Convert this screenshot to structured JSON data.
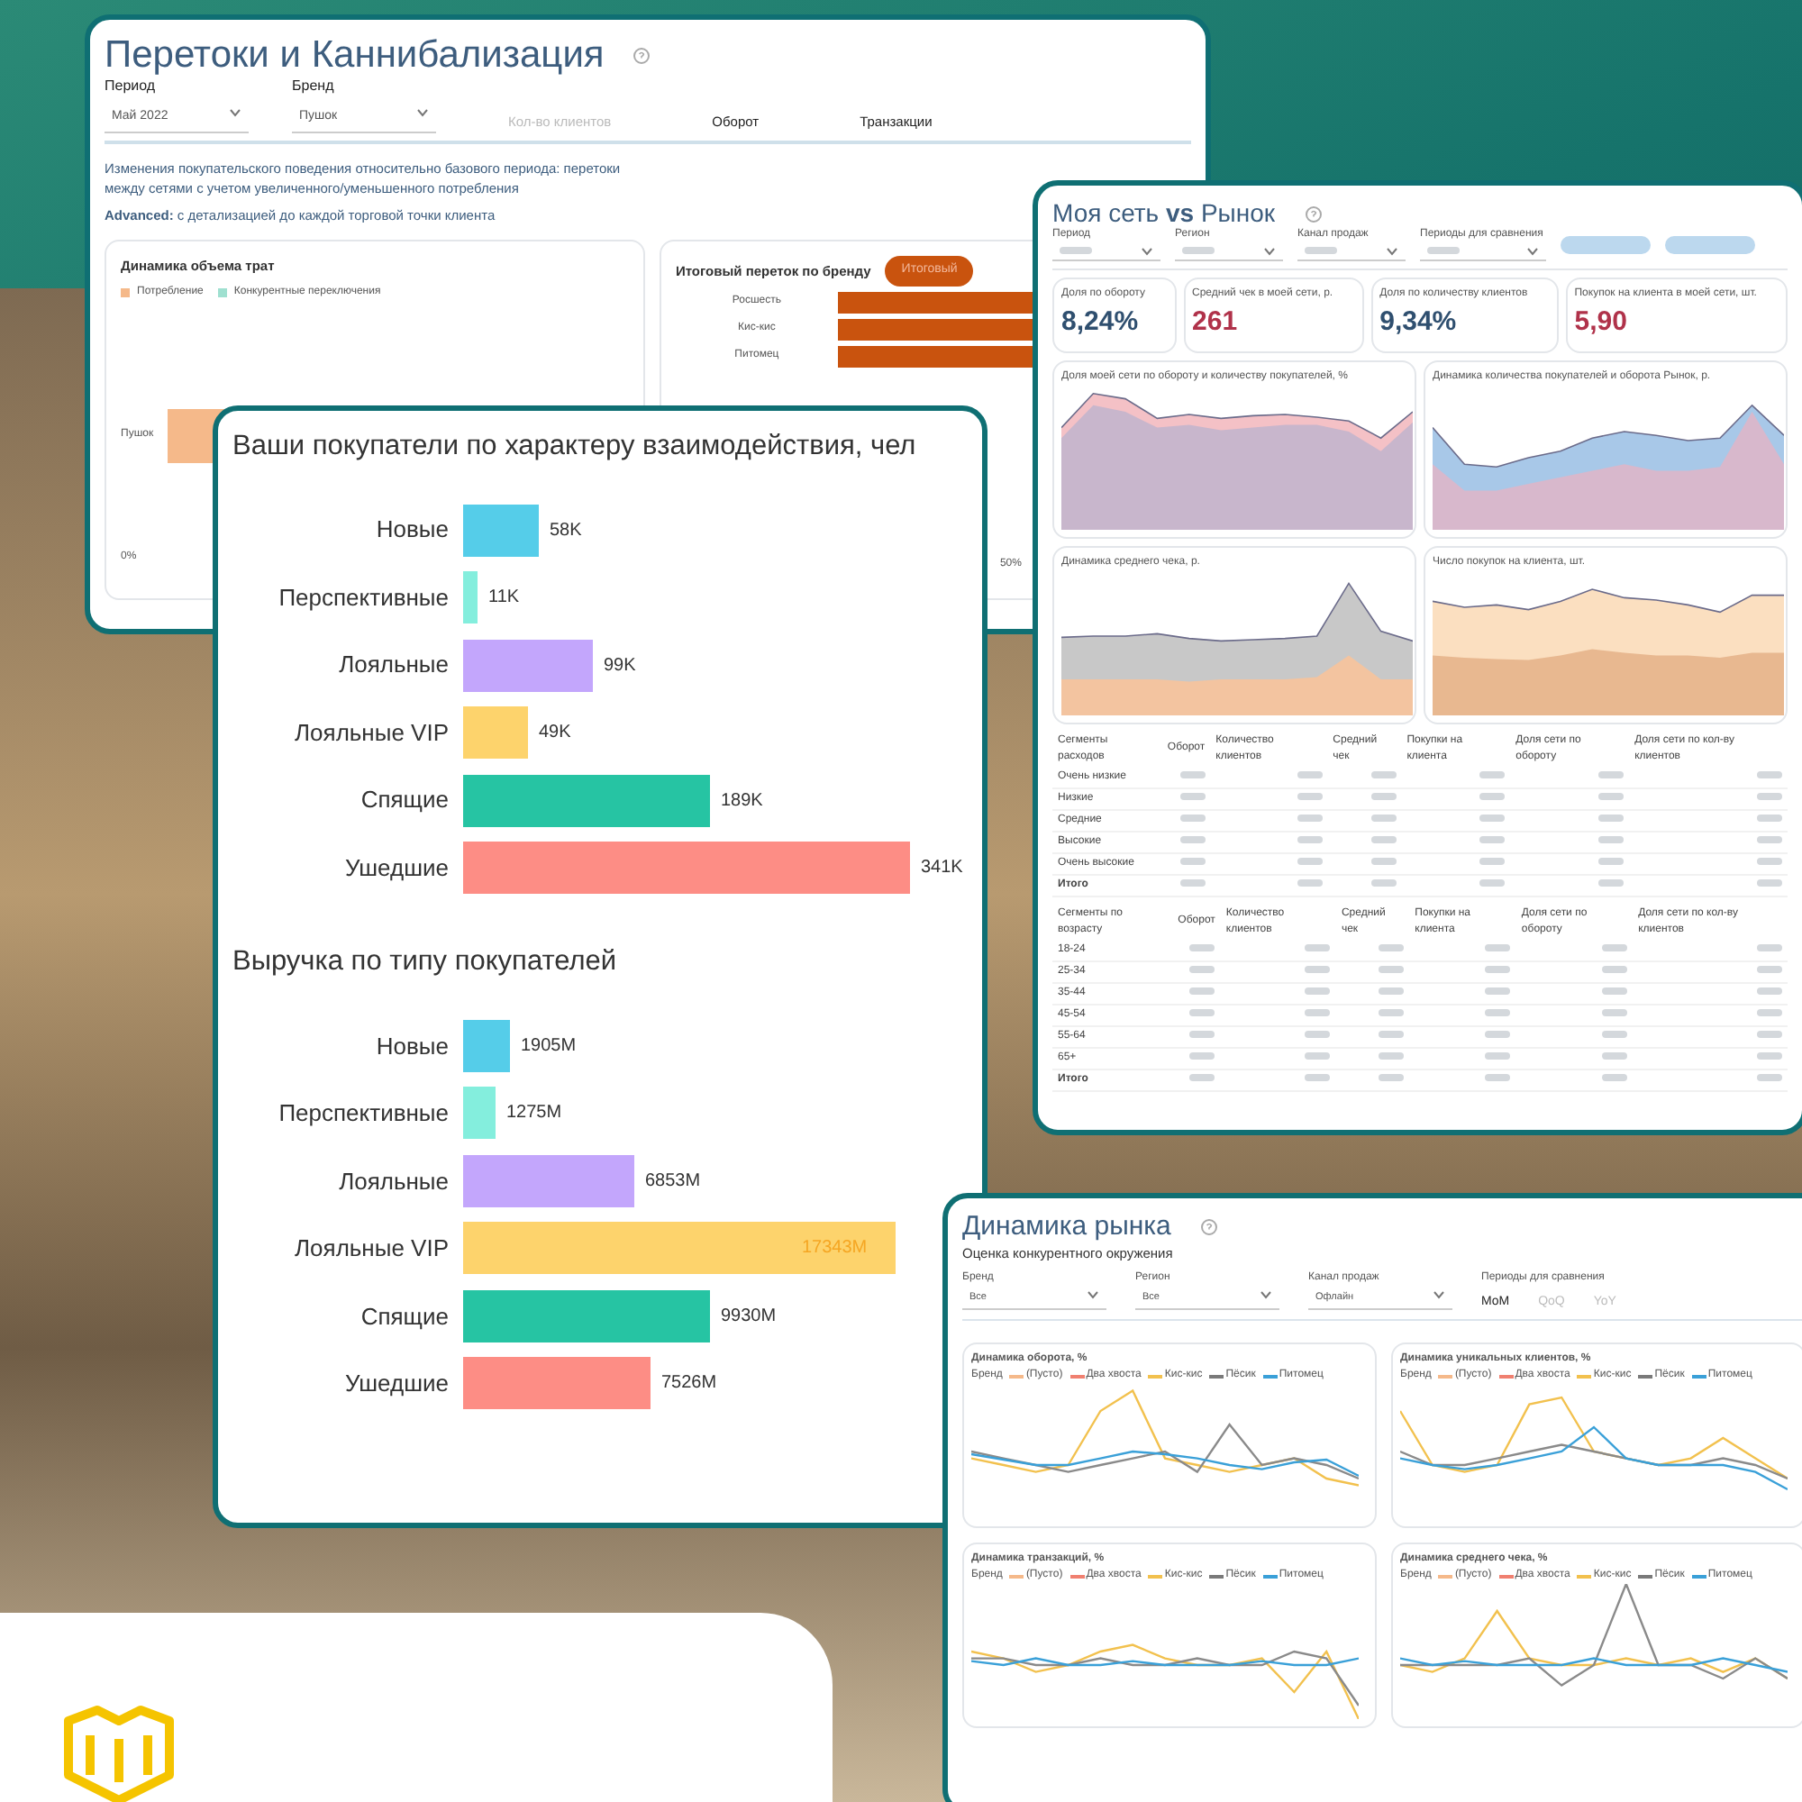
{
  "flows_panel": {
    "title": "Перетоки и Каннибализация",
    "filters": [
      {
        "label": "Период",
        "value": "Май 2022"
      },
      {
        "label": "Бренд",
        "value": "Пушок"
      }
    ],
    "measures": [
      {
        "label": "Кол-во клиентов",
        "dimmed": true
      },
      {
        "label": "Оборот",
        "dimmed": false
      },
      {
        "label": "Транзакции",
        "dimmed": false
      }
    ],
    "description": "Изменения покупательского поведения относительно базового периода: перетоки между сетями с учетом увеличенного/уменьшенного потребления",
    "advanced": "**Advanced:** с детализацией до каждой торговой точки клиента",
    "spend_card": {
      "title": "Динамика объема трат",
      "legend": [
        {
          "label": "Потребление",
          "color": "#f5b98a"
        },
        {
          "label": "Конкурентные переключения",
          "color": "#9fe0d0"
        }
      ],
      "row_label": "Пушок",
      "axis": "0%"
    },
    "brand_card": {
      "title": "Итоговый переток по бренду",
      "button": "Итоговый",
      "rows": [
        "Росшесть",
        "Кис-кис",
        "Питомец"
      ],
      "axis": "50%"
    }
  },
  "market_panel": {
    "title": "Моя сеть **vs** Рынок",
    "filters": [
      "Период",
      "Регион",
      "Канал продаж",
      "Периоды для сравнения"
    ],
    "kpis": [
      {
        "label": "Доля по обороту",
        "value": "8,24%",
        "color": "#2f4f6f"
      },
      {
        "label": "Средний чек в моей сети, р.",
        "value": "261",
        "color": "#b0324a"
      },
      {
        "label": "Доля по количеству клиентов",
        "value": "9,34%",
        "color": "#2f4f6f"
      },
      {
        "label": "Покупок на клиента в моей сети, шт.",
        "value": "5,90",
        "color": "#b0324a"
      }
    ],
    "charts": [
      {
        "title": "Доля моей сети по обороту и количеству покупателей, %",
        "kind": "share"
      },
      {
        "title": "Динамика количества покупателей и оборота Рынок, р.",
        "kind": "dynamics"
      },
      {
        "title": "Динамика среднего чека, р.",
        "kind": "check"
      },
      {
        "title": "Число покупок на клиента, шт.",
        "kind": "purchases"
      }
    ],
    "tables": [
      {
        "header": "Сегменты расходов",
        "columns": [
          "Оборот",
          "Количество клиентов",
          "Средний чек",
          "Покупки на клиента",
          "Доля сети по обороту",
          "Доля сети по кол-ву клиентов"
        ],
        "rows": [
          "Очень низкие",
          "Низкие",
          "Средние",
          "Высокие",
          "Очень высокие",
          "Итого"
        ]
      },
      {
        "header": "Сегменты по возрасту",
        "columns": [
          "Оборот",
          "Количество клиентов",
          "Средний чек",
          "Покупки на клиента",
          "Доля сети по обороту",
          "Доля сети по кол-ву клиентов"
        ],
        "rows": [
          "18-24",
          "25-34",
          "35-44",
          "45-54",
          "55-64",
          "65+",
          "Итого"
        ]
      }
    ]
  },
  "customers_panel": {
    "charts": [
      {
        "chart_data": {
          "type": "bar",
          "orientation": "horizontal",
          "title": "Ваши покупатели по характеру взаимодействия, чел",
          "categories": [
            "Новые",
            "Перспективные",
            "Лояльные",
            "Лояльные VIP",
            "Спящие",
            "Ушедшие"
          ],
          "colors": [
            "#55cde9",
            "#84eedd",
            "#c3a6fc",
            "#fdd36c",
            "#26c4a3",
            "#fd8d85"
          ],
          "series": [
            {
              "values": [
                58,
                11,
                99,
                49,
                189,
                341
              ],
              "value_labels": [
                "58K",
                "11K",
                "99K",
                "49K",
                "189K",
                "341K"
              ]
            }
          ]
        }
      },
      {
        "chart_data": {
          "type": "bar",
          "orientation": "horizontal",
          "title": "Выручка по типу покупателей",
          "categories": [
            "Новые",
            "Перспективные",
            "Лояльные",
            "Лояльные VIP",
            "Спящие",
            "Ушедшие"
          ],
          "colors": [
            "#55cde9",
            "#84eedd",
            "#c3a6fc",
            "#fdd36c",
            "#26c4a3",
            "#fd8d85"
          ],
          "series": [
            {
              "values": [
                1905,
                1275,
                6853,
                17343,
                9930,
                7526
              ],
              "value_labels": [
                "1905M",
                "1275M",
                "6853M",
                "17343M",
                "9930M",
                "7526M"
              ]
            }
          ]
        }
      }
    ]
  },
  "dynamics_panel": {
    "title": "Динамика рынка",
    "subtitle": "Оценка конкурентного окружения",
    "filters": [
      {
        "label": "Бренд",
        "value": "Все"
      },
      {
        "label": "Регион",
        "value": "Все"
      },
      {
        "label": "Канал продаж",
        "value": "Офлайн"
      }
    ],
    "comparison": {
      "label": "Периоды для сравнения",
      "options": [
        {
          "label": "MoM",
          "selected": true
        },
        {
          "label": "QoQ",
          "selected": false
        },
        {
          "label": "YoY",
          "selected": false
        }
      ]
    },
    "charts": [
      {
        "title": "Динамика оборота, %",
        "kind": "turnover",
        "legend_title": "Бренд",
        "legend": [
          {
            "label": "(Пусто)",
            "color": "#f5b98a"
          },
          {
            "label": "Два хвоста",
            "color": "#f08070"
          },
          {
            "label": "Кис-кис",
            "color": "#f2c14e"
          },
          {
            "label": "Пёсик",
            "color": "#7a7a7a"
          },
          {
            "label": "Питомец",
            "color": "#3aa0d8"
          }
        ]
      },
      {
        "title": "Динамика уникальных клиентов, %",
        "kind": "clients",
        "legend_title": "Бренд",
        "legend": [
          {
            "label": "(Пусто)",
            "color": "#f5b98a"
          },
          {
            "label": "Два хвоста",
            "color": "#f08070"
          },
          {
            "label": "Кис-кис",
            "color": "#f2c14e"
          },
          {
            "label": "Пёсик",
            "color": "#7a7a7a"
          },
          {
            "label": "Питомец",
            "color": "#3aa0d8"
          }
        ]
      },
      {
        "title": "Динамика транзакций, %",
        "kind": "transactions",
        "legend_title": "Бренд",
        "legend": [
          {
            "label": "(Пусто)",
            "color": "#f5b98a"
          },
          {
            "label": "Два хвоста",
            "color": "#f08070"
          },
          {
            "label": "Кис-кис",
            "color": "#f2c14e"
          },
          {
            "label": "Пёсик",
            "color": "#7a7a7a"
          },
          {
            "label": "Питомец",
            "color": "#3aa0d8"
          }
        ]
      },
      {
        "title": "Динамика среднего чека, %",
        "kind": "check",
        "legend_title": "Бренд",
        "legend": [
          {
            "label": "(Пусто)",
            "color": "#f5b98a"
          },
          {
            "label": "Два хвоста",
            "color": "#f08070"
          },
          {
            "label": "Кис-кис",
            "color": "#f2c14e"
          },
          {
            "label": "Пёсик",
            "color": "#7a7a7a"
          },
          {
            "label": "Питомец",
            "color": "#3aa0d8"
          }
        ]
      }
    ]
  }
}
